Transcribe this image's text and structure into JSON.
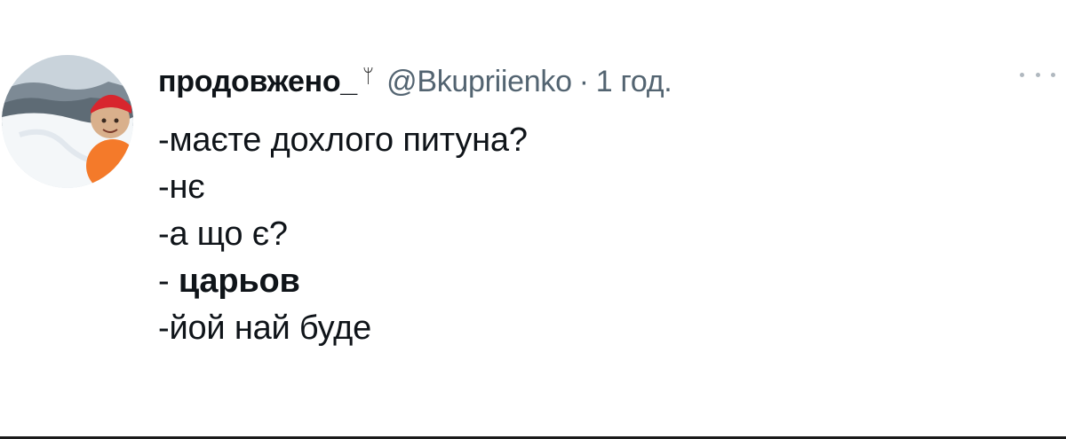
{
  "tweet": {
    "display_name": "продовжено_",
    "name_emoji": "ᛘ",
    "handle": "@Bkupriienko",
    "separator": "·",
    "timestamp": "1 год.",
    "more_icon": "ellipsis-icon",
    "lines": [
      {
        "prefix": "-",
        "text": "маєте дохлого питуна?"
      },
      {
        "prefix": "-",
        "text": "нє"
      },
      {
        "prefix": "-",
        "text": "а що є?"
      },
      {
        "prefix": "- ",
        "text": "царьов"
      },
      {
        "prefix": "-",
        "text": "йой най буде"
      }
    ]
  },
  "colors": {
    "text_primary": "#0f1419",
    "text_secondary": "#536471",
    "background": "#ffffff"
  }
}
